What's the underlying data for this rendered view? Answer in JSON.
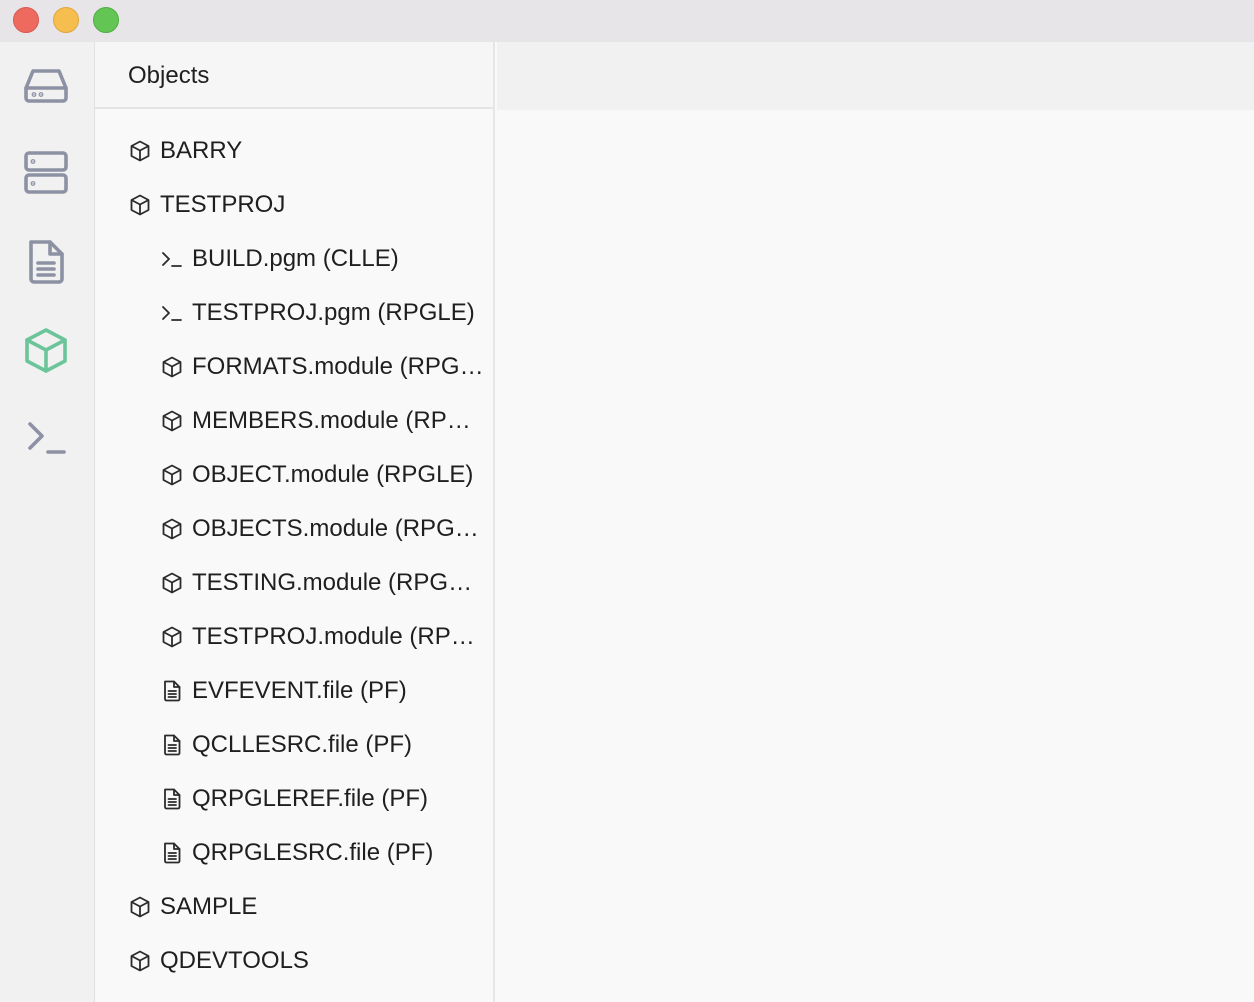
{
  "window": {
    "controls": [
      "close",
      "minimize",
      "maximize"
    ]
  },
  "activity_bar": {
    "items": [
      {
        "icon": "drive-icon"
      },
      {
        "icon": "server-icon"
      },
      {
        "icon": "document-icon"
      },
      {
        "icon": "cube-icon",
        "active": true
      },
      {
        "icon": "terminal-icon"
      }
    ],
    "active_color": "#6cc59a",
    "inactive_color": "#8c92a3"
  },
  "sidebar": {
    "title": "Objects",
    "tree": [
      {
        "label": "BARRY",
        "icon": "cube-icon"
      },
      {
        "label": "TESTPROJ",
        "icon": "cube-icon"
      },
      {
        "label": "BUILD.pgm (CLLE)",
        "icon": "terminal-icon"
      },
      {
        "label": "TESTPROJ.pgm (RPGLE)",
        "icon": "terminal-icon"
      },
      {
        "label": "FORMATS.module (RPGLE)",
        "icon": "cube-icon"
      },
      {
        "label": "MEMBERS.module (RPGLE)",
        "icon": "cube-icon"
      },
      {
        "label": "OBJECT.module (RPGLE)",
        "icon": "cube-icon"
      },
      {
        "label": "OBJECTS.module (RPGLE)",
        "icon": "cube-icon"
      },
      {
        "label": "TESTING.module (RPGLE)",
        "icon": "cube-icon"
      },
      {
        "label": "TESTPROJ.module (RPGLE)",
        "icon": "cube-icon"
      },
      {
        "label": "EVFEVENT.file (PF)",
        "icon": "file-icon"
      },
      {
        "label": "QCLLESRC.file (PF)",
        "icon": "file-icon"
      },
      {
        "label": "QRPGLEREF.file (PF)",
        "icon": "file-icon"
      },
      {
        "label": "QRPGLESRC.file (PF)",
        "icon": "file-icon"
      },
      {
        "label": "SAMPLE",
        "icon": "cube-icon"
      },
      {
        "label": "QDEVTOOLS",
        "icon": "cube-icon"
      }
    ]
  }
}
